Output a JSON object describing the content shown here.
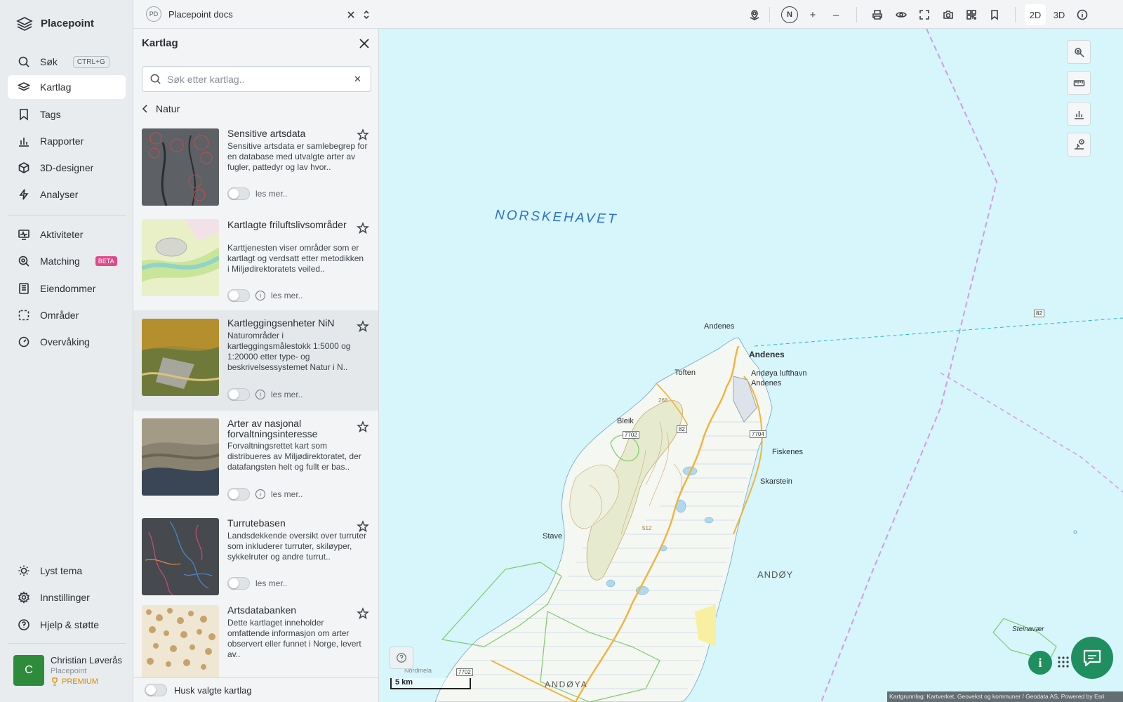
{
  "app": {
    "name": "Placepoint"
  },
  "nav": {
    "items": [
      {
        "label": "Søk",
        "shortcut": "CTRL+G",
        "icon": "search-icon"
      },
      {
        "label": "Kartlag",
        "icon": "layers-icon",
        "active": true
      },
      {
        "label": "Tags",
        "icon": "bookmark-icon"
      },
      {
        "label": "Rapporter",
        "icon": "bar-chart-icon"
      },
      {
        "label": "3D-designer",
        "icon": "cube-icon"
      },
      {
        "label": "Analyser",
        "icon": "bolt-icon"
      },
      {
        "label": "Aktiviteter",
        "icon": "monitor-activity-icon"
      },
      {
        "label": "Matching",
        "badge": "BETA",
        "icon": "zoom-search-icon"
      },
      {
        "label": "Eiendommer",
        "icon": "building-icon"
      },
      {
        "label": "Områder",
        "icon": "dashed-square-icon"
      },
      {
        "label": "Overvåking",
        "icon": "gauge-icon"
      }
    ],
    "bottom_items": [
      {
        "label": "Lyst tema",
        "icon": "sun-icon"
      },
      {
        "label": "Innstillinger",
        "icon": "gear-icon"
      },
      {
        "label": "Hjelp & støtte",
        "icon": "help-circle-icon"
      }
    ],
    "user": {
      "initial": "C",
      "name": "Christian Løverås",
      "org": "Placepoint",
      "plan": "PREMIUM"
    }
  },
  "topbar": {
    "workspace_initials": "PD",
    "workspace_name": "Placepoint docs",
    "compass": "N",
    "zoom_in": "+",
    "zoom_out": "–",
    "mode_2d": "2D",
    "mode_3d": "3D",
    "active_mode": "2D"
  },
  "panel": {
    "title": "Kartlag",
    "search_placeholder": "Søk etter kartlag..",
    "back_label": "Natur",
    "read_more": "les mer..",
    "remember_label": "Husk valgte kartlag",
    "layers": [
      {
        "title": "Sensitive artsdata",
        "description": "Sensitive artsdata er samlebegrep for en database med utvalgte arter av fugler, pattedyr og lav hvor..",
        "enabled": false,
        "has_info": false
      },
      {
        "title": "Kartlagte friluftslivsområder",
        "description": "Karttjenesten viser områder som er kartlagt og verdsatt etter metodikken i Miljødirektoratets veiled..",
        "enabled": false,
        "has_info": true
      },
      {
        "title": "Kartleggingsenheter NiN",
        "description": "Naturområder i kartleggingsmålestokk 1:5000 og 1:20000 etter type- og beskrivelsessystemet Natur i N..",
        "enabled": false,
        "has_info": true
      },
      {
        "title": "Arter av nasjonal forvaltningsinteresse",
        "description": "Forvaltningsrettet kart som distribueres av Miljødirektoratet, der datafangsten helt og fullt er bas..",
        "enabled": false,
        "has_info": true
      },
      {
        "title": "Turrutebasen",
        "description": "Landsdekkende oversikt over turruter som inkluderer turruter, skiløyper, sykkelruter og andre turrut..",
        "enabled": false,
        "has_info": false
      },
      {
        "title": "Artsdatabanken",
        "description": "Dette kartlaget inneholder omfattende informasjon om arter observert eller funnet i Norge, levert av..",
        "enabled": false,
        "has_info": false
      }
    ]
  },
  "map": {
    "sea_label": "NORSKEHAVET",
    "places": [
      "Andenes",
      "Andenes",
      "Andøya lufthavn Andenes",
      "Toften",
      "Bleik",
      "Fiskenes",
      "Skarstein",
      "Stave",
      "ANDØY",
      "Steinavær",
      "Nordmela",
      "ANDØYA"
    ],
    "road_numbers": [
      "82",
      "7702",
      "7704",
      "82",
      "82",
      "7702"
    ],
    "elevations": [
      "268",
      "512"
    ],
    "scale_label": "5 km",
    "attribution": "Kartgrunnlag: Kartverket, Geovekst og kommuner / Geodata AS, Powered by Esri",
    "info_button": "i"
  },
  "colors": {
    "accent_green": "#1f8f5f",
    "sea": "#d6f6fb",
    "land": "#f4f6f3",
    "beta_pink": "#e2498a",
    "premium": "#d98a00"
  }
}
